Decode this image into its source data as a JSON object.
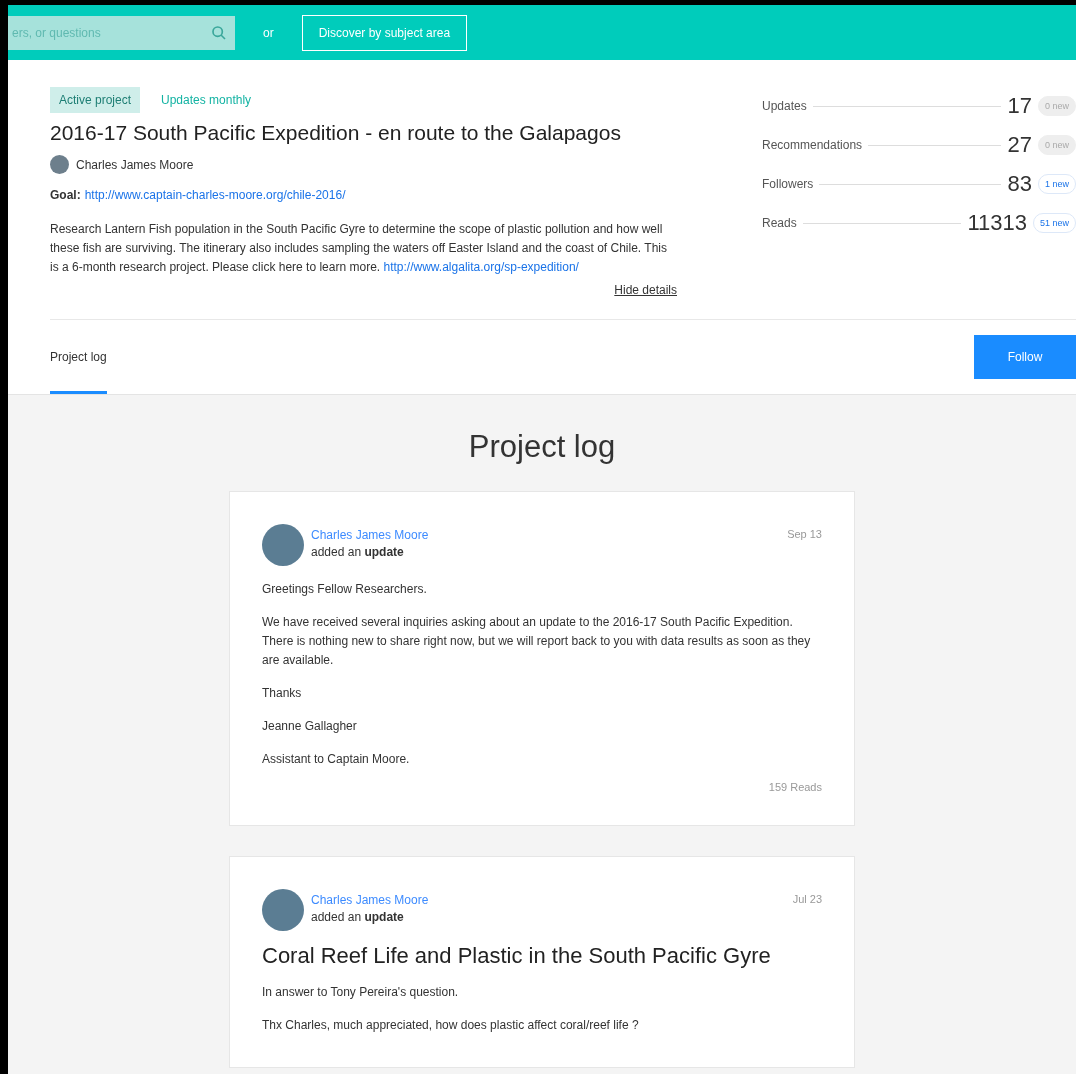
{
  "header": {
    "search": {
      "placeholder": "ers, or questions"
    },
    "separator": "or",
    "discover_button": "Discover by subject area"
  },
  "project": {
    "badges": [
      {
        "label": "Active project",
        "kind": "status"
      },
      {
        "label": "Updates monthly",
        "kind": "frequency"
      }
    ],
    "title": "2016-17 South Pacific Expedition - en route to the Galapagos",
    "author": "Charles James Moore",
    "goal_label": "Goal:",
    "goal_link": "http://www.captain-charles-moore.org/chile-2016/",
    "description": "Research Lantern Fish population in the South Pacific Gyre to determine the scope of plastic pollution and how well these fish are surviving. The itinerary also includes sampling the waters off Easter Island and the coast of Chile. This is a 6-month research project. Please click here to learn more.",
    "description_link": "http://www.algalita.org/sp-expedition/",
    "hide_details": "Hide details"
  },
  "stats": [
    {
      "label": "Updates",
      "value": "17",
      "new": "0 new",
      "highlighted": false
    },
    {
      "label": "Recommendations",
      "value": "27",
      "new": "0 new",
      "highlighted": false
    },
    {
      "label": "Followers",
      "value": "83",
      "new": "1 new",
      "highlighted": true
    },
    {
      "label": "Reads",
      "value": "11313",
      "new": "51 new",
      "highlighted": true
    }
  ],
  "tabs": [
    {
      "label": "Project log",
      "selected": true
    }
  ],
  "follow_button": "Follow",
  "log": {
    "heading": "Project log",
    "entries": [
      {
        "author": "Charles James Moore",
        "action": "added an **update**",
        "date": "Sep 13",
        "paragraphs": [
          "Greetings Fellow Researchers.",
          "We have received several inquiries asking about an update to the 2016-17 South Pacific Expedition. There is nothing new to share right now, but we will report back to you with data results as soon as they are available.",
          "Thanks",
          "Jeanne Gallagher",
          "Assistant to Captain Moore."
        ],
        "reads": "159 Reads"
      },
      {
        "author": "Charles James Moore",
        "action": "added an **update**",
        "date": "Jul 23",
        "title": "Coral Reef Life and Plastic in the South Pacific Gyre",
        "paragraphs": [
          "In answer to Tony Pereira's question.",
          "Thx Charles, much appreciated, how does plastic affect coral/reef life ?"
        ]
      }
    ]
  }
}
